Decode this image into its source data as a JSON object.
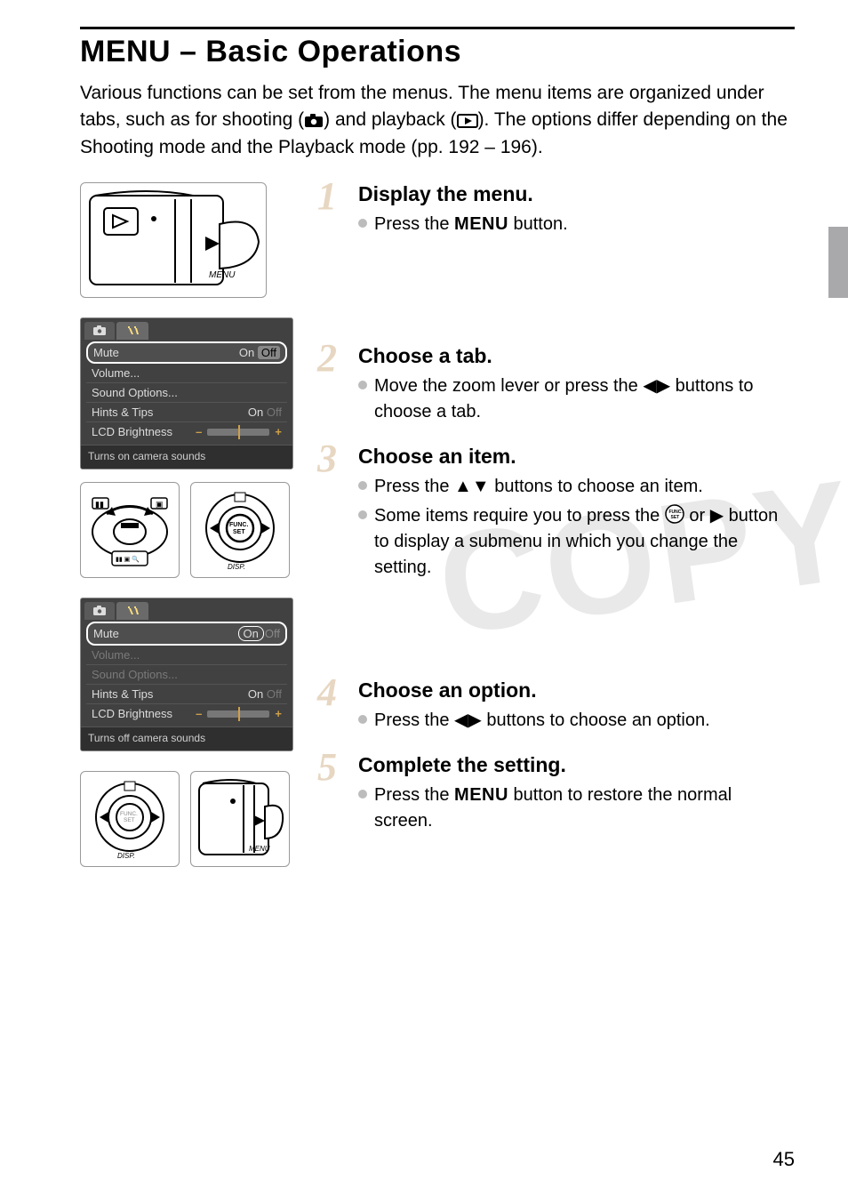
{
  "title": "MENU – Basic Operations",
  "intro": {
    "part1": "Various functions can be set from the menus. The menu items are organized under tabs, such as for shooting (",
    "part2": ") and playback (",
    "part3": "). The options differ depending on the Shooting mode and the Playback mode (pp. 192 – 196)."
  },
  "watermark": "COPY",
  "steps": [
    {
      "num": "1",
      "heading": "Display the menu.",
      "bullets": [
        {
          "pre": "Press the ",
          "strong": "MENU",
          "post": " button."
        }
      ]
    },
    {
      "num": "2",
      "heading": "Choose a tab.",
      "bullets": [
        {
          "pre": "Move the zoom lever or press the ",
          "glyph": "◀▶",
          "post": " buttons to choose a tab."
        }
      ]
    },
    {
      "num": "3",
      "heading": "Choose an item.",
      "bullets": [
        {
          "pre": "Press the ",
          "glyph": "▲▼",
          "post": " buttons to choose an item."
        },
        {
          "text": "Some items require you to press the (FUNC./SET) or ▶ button to display a submenu in which you change the setting."
        }
      ]
    },
    {
      "num": "4",
      "heading": "Choose an option.",
      "bullets": [
        {
          "pre": "Press the ",
          "glyph": "◀▶",
          "post": " buttons to choose an option."
        }
      ]
    },
    {
      "num": "5",
      "heading": "Complete the setting.",
      "bullets": [
        {
          "pre": "Press the ",
          "strong": "MENU",
          "post": " button to restore the normal screen."
        }
      ]
    }
  ],
  "lcd1": {
    "tab_cam": "📷",
    "tab_tools": "🛠",
    "rows": {
      "mute": "Mute",
      "mute_on": "On",
      "mute_off": "Off",
      "volume": "Volume...",
      "sound": "Sound Options...",
      "hints": "Hints & Tips",
      "hints_on": "On",
      "hints_off": "Off",
      "bright": "LCD Brightness"
    },
    "caption": "Turns on camera sounds"
  },
  "lcd2": {
    "tab_cam": "📷",
    "tab_tools": "🛠",
    "rows": {
      "mute": "Mute",
      "mute_on": "On",
      "mute_off": "Off",
      "volume": "Volume...",
      "sound": "Sound Options...",
      "hints": "Hints & Tips",
      "hints_on": "On",
      "hints_off": "Off",
      "bright": "LCD Brightness"
    },
    "caption": "Turns off camera sounds"
  },
  "labels": {
    "menu_btn": "MENU",
    "func": "FUNC.",
    "set": "SET",
    "disp": "DISP."
  },
  "page_number": "45"
}
